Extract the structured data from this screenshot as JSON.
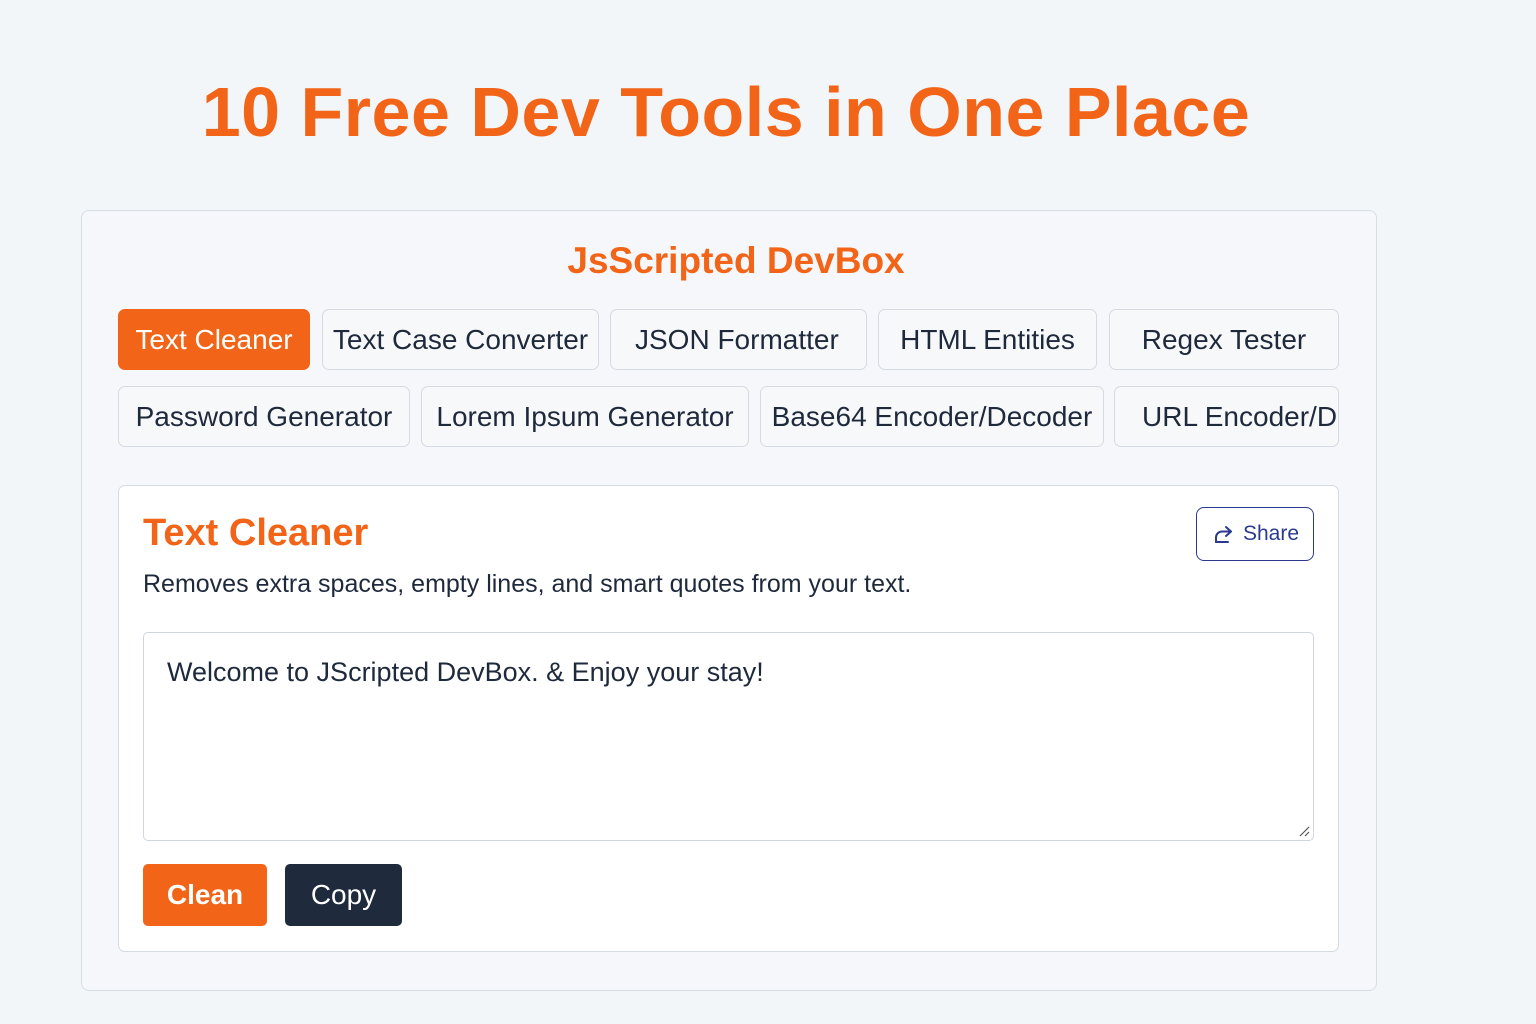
{
  "hero": {
    "title": "10 Free Dev Tools in One Place"
  },
  "devbox": {
    "title": "JsScripted DevBox",
    "tabs": [
      {
        "label": "Text Cleaner",
        "active": true
      },
      {
        "label": "Text Case Converter",
        "active": false
      },
      {
        "label": "JSON Formatter",
        "active": false
      },
      {
        "label": "HTML Entities",
        "active": false
      },
      {
        "label": "Regex Tester",
        "active": false
      },
      {
        "label": "Password Generator",
        "active": false
      },
      {
        "label": "Lorem Ipsum Generator",
        "active": false
      },
      {
        "label": "Base64 Encoder/Decoder",
        "active": false
      },
      {
        "label": "URL Encoder/D",
        "active": false
      }
    ]
  },
  "tool": {
    "title": "Text Cleaner",
    "description": "Removes extra spaces, empty lines, and smart quotes from your text.",
    "share_label": "Share",
    "share_icon": "share-icon",
    "input_value": "Welcome to JScripted DevBox. & Enjoy your stay!",
    "clean_label": "Clean",
    "copy_label": "Copy"
  },
  "colors": {
    "accent": "#f26418",
    "dark_button": "#1f2b3d",
    "share_border": "#2b3a8f",
    "background": "#f3f6f9"
  }
}
